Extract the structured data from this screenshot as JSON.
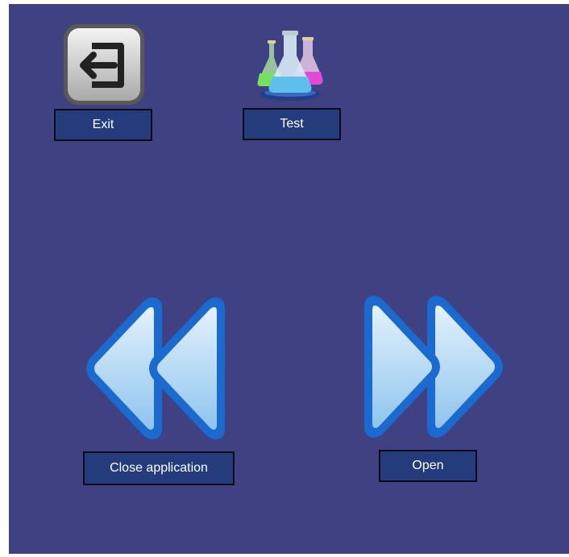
{
  "desktop": {
    "background_color": "#3f4183",
    "icons": [
      {
        "label": "Exit",
        "icon": "exit-door-arrow-icon"
      },
      {
        "label": "Test",
        "icon": "lab-flasks-icon"
      },
      {
        "label": "Close application",
        "icon": "double-chevron-left-icon"
      },
      {
        "label": "Open",
        "icon": "double-chevron-right-icon"
      }
    ]
  },
  "colors": {
    "label_bg": "#243c7c",
    "arrow_blue": "#1d6fd1",
    "arrow_fill": "#b9dcf6"
  }
}
